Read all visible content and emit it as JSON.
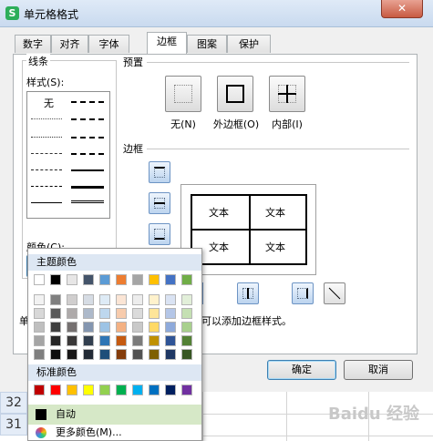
{
  "window": {
    "app_icon_text": "S",
    "title": "单元格格式",
    "close_symbol": "✕"
  },
  "tabs": [
    {
      "label": "数字",
      "active": false
    },
    {
      "label": "对齐",
      "active": false
    },
    {
      "label": "字体",
      "active": false
    },
    {
      "label": "边框",
      "active": true
    },
    {
      "label": "图案",
      "active": false
    },
    {
      "label": "保护",
      "active": false
    }
  ],
  "line_group": {
    "title": "线条",
    "style_label": "样式(S):",
    "none_label": "无",
    "color_label": "颜色(C):",
    "color_value": "自动"
  },
  "presets": {
    "title": "预置",
    "items": [
      {
        "label": "无(N)",
        "icon": "preset-none-icon"
      },
      {
        "label": "外边框(O)",
        "icon": "preset-outline-icon"
      },
      {
        "label": "内部(I)",
        "icon": "preset-inside-icon"
      }
    ]
  },
  "border": {
    "title": "边框",
    "preview_cells": [
      "文本",
      "文本",
      "文本",
      "文本"
    ]
  },
  "hint": {
    "left_fragment": "单",
    "right_fragment": "可以添加边框样式。"
  },
  "buttons": {
    "ok": "确定",
    "cancel": "取消"
  },
  "sheet": {
    "rows": [
      "32",
      "31"
    ]
  },
  "watermark": "Baidu 经验",
  "color_popup": {
    "theme_title": "主题颜色",
    "standard_title": "标准颜色",
    "auto_label": "自动",
    "more_label": "更多颜色(M)...",
    "theme_top": [
      "#ffffff",
      "#000000",
      "#e7e6e6",
      "#44546a",
      "#5b9bd5",
      "#ed7d31",
      "#a5a5a5",
      "#ffc000",
      "#4472c4",
      "#70ad47"
    ],
    "theme_shades": [
      [
        "#f2f2f2",
        "#7f7f7f",
        "#d0cece",
        "#d6dce4",
        "#deebf6",
        "#fbe5d5",
        "#ededed",
        "#fff2cc",
        "#dae3f3",
        "#e2efd9"
      ],
      [
        "#d8d8d8",
        "#595959",
        "#aeaaaa",
        "#adb9ca",
        "#bdd7ee",
        "#f7cbac",
        "#dbdbdb",
        "#fee599",
        "#b4c6e7",
        "#c5e0b3"
      ],
      [
        "#bfbfbf",
        "#3f3f3f",
        "#757070",
        "#8496b0",
        "#9cc3e5",
        "#f4b183",
        "#c9c9c9",
        "#ffd965",
        "#8eaadb",
        "#a8d08d"
      ],
      [
        "#a5a5a5",
        "#262626",
        "#3a3838",
        "#323f4f",
        "#2e75b5",
        "#c55a11",
        "#7b7b7b",
        "#bf9000",
        "#2f5496",
        "#538135"
      ],
      [
        "#7f7f7f",
        "#0c0c0c",
        "#171616",
        "#222a35",
        "#1e4e79",
        "#843c0b",
        "#525252",
        "#7f6000",
        "#1f3864",
        "#375623"
      ]
    ],
    "standard": [
      "#c00000",
      "#ff0000",
      "#ffc000",
      "#ffff00",
      "#92d050",
      "#00b050",
      "#00b0f0",
      "#0070c0",
      "#002060",
      "#7030a0"
    ]
  }
}
